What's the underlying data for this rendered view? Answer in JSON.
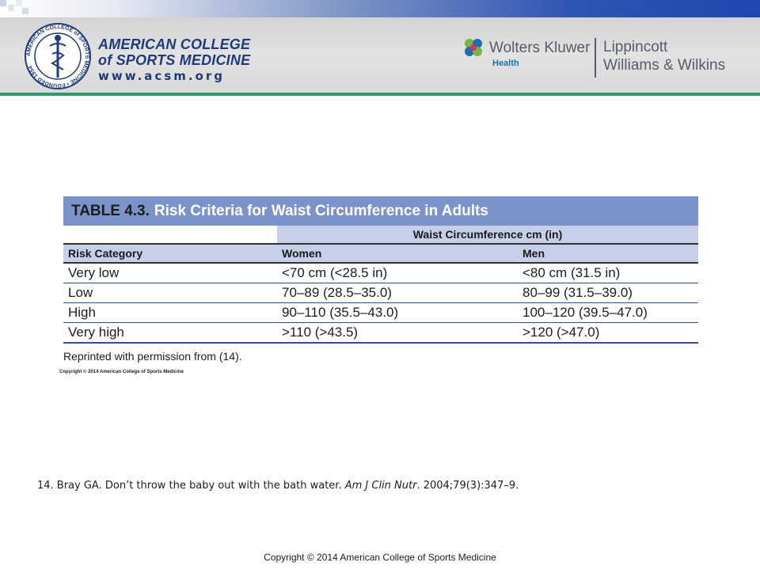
{
  "header": {
    "acsm": {
      "seal_text": "AMERICAN COLLEGE of SPORTS MEDICINE • FOUNDED 1954",
      "line1": "AMERICAN COLLEGE",
      "line2": "of SPORTS MEDICINE",
      "url": "www.acsm.org"
    },
    "publisher": {
      "wk_name": "Wolters Kluwer",
      "wk_health": "Health",
      "lww_line1": "Lippincott",
      "lww_line2": "Williams & Wilkins"
    },
    "colors": {
      "accent_rule": "#2c9a6c",
      "title_bar": "#7b93c9",
      "header_fill": "#c5d0e8"
    }
  },
  "table": {
    "label": "TABLE 4.3.",
    "title": "Risk Criteria for Waist Circumference in Adults",
    "span_header": "Waist Circumference cm (in)",
    "columns": [
      "Risk Category",
      "Women",
      "Men"
    ],
    "rows": [
      [
        "Very low",
        "<70 cm (<28.5 in)",
        "<80 cm (31.5 in)"
      ],
      [
        "Low",
        "70–89 (28.5–35.0)",
        "80–99 (31.5–39.0)"
      ],
      [
        "High",
        "90–110 (35.5–43.0)",
        "100–120 (39.5–47.0)"
      ],
      [
        "Very high",
        ">110 (>43.5)",
        ">120 (>47.0)"
      ]
    ],
    "reprint_note": "Reprinted with permission from (14).",
    "tiny_copyright": "Copyright © 2014 American College of Sports Medicine"
  },
  "reference": {
    "prefix": "14. Bray GA. Don’t throw the baby out with the bath water.",
    "journal": "Am J Clin Nutr",
    "suffix": ". 2004;79(3):347–9."
  },
  "footer": {
    "copyright": "Copyright © 2014 American College of Sports Medicine"
  }
}
